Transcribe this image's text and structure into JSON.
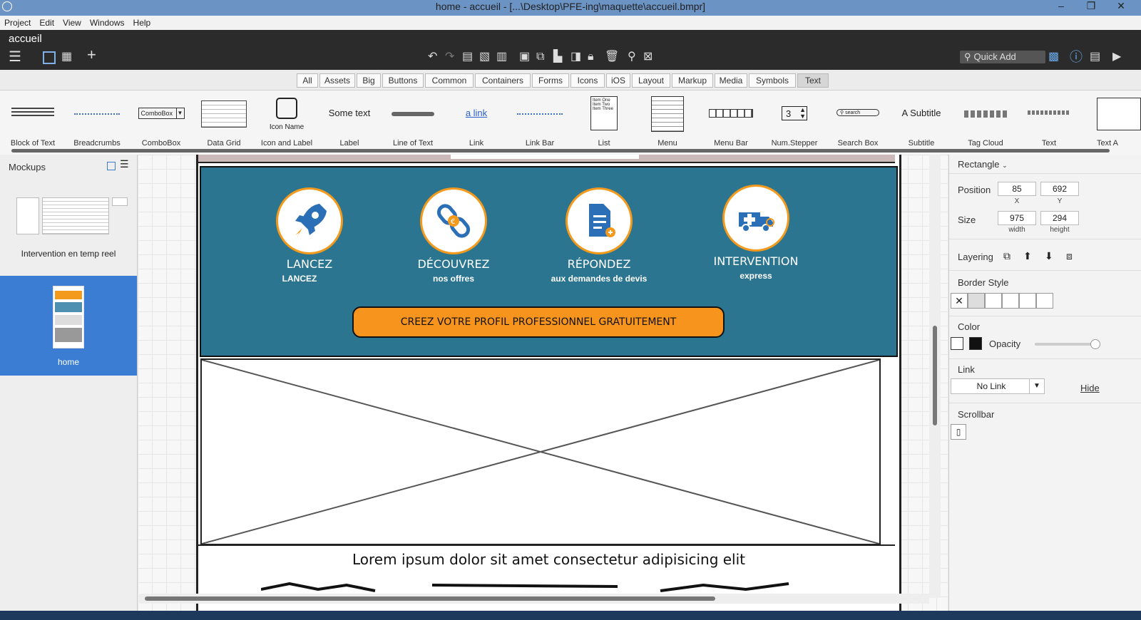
{
  "window": {
    "title": "home - accueil - [...\\Desktop\\PFE-ing\\maquette\\accueil.bmpr]",
    "minimize": "–",
    "maximize": "❐",
    "close": "✕"
  },
  "menubar": [
    "Project",
    "Edit",
    "View",
    "Windows",
    "Help"
  ],
  "document_title": "accueil",
  "quick_add": "Quick Add",
  "filters": [
    "All",
    "Assets",
    "Big",
    "Buttons",
    "Common",
    "Containers",
    "Forms",
    "Icons",
    "iOS",
    "Layout",
    "Markup",
    "Media",
    "Symbols",
    "Text"
  ],
  "active_filter": "Text",
  "library": {
    "items": [
      {
        "label": "Block of Text"
      },
      {
        "label": "Breadcrumbs"
      },
      {
        "label": "ComboBox",
        "preview": "ComboBox"
      },
      {
        "label": "Data Grid"
      },
      {
        "label": "Icon and Label",
        "preview": "Icon Name"
      },
      {
        "label": "Label",
        "preview": "Some text"
      },
      {
        "label": "Line of Text"
      },
      {
        "label": "Link",
        "preview": "a link"
      },
      {
        "label": "Link Bar"
      },
      {
        "label": "List",
        "preview_lines": [
          "Item One",
          "Item Two",
          "Item Three"
        ]
      },
      {
        "label": "Menu"
      },
      {
        "label": "Menu Bar"
      },
      {
        "label": "Num.Stepper",
        "preview": "3"
      },
      {
        "label": "Search Box",
        "preview": "search"
      },
      {
        "label": "Subtitle",
        "preview": "A Subtitle"
      },
      {
        "label": "Tag Cloud"
      },
      {
        "label": "Text"
      },
      {
        "label": "Text A"
      }
    ]
  },
  "mockups": {
    "title": "Mockups",
    "items": [
      {
        "label": "Intervention en temp reel",
        "selected": false
      },
      {
        "label": "home",
        "selected": true
      }
    ]
  },
  "canvas": {
    "features": [
      {
        "title": "LANCEZ",
        "subtitle": "LANCEZ",
        "icon": "rocket-icon"
      },
      {
        "title": "DÉCOUVREZ",
        "subtitle": "nos offres",
        "icon": "link-euro-icon"
      },
      {
        "title": "RÉPONDEZ",
        "subtitle": "aux demandes de devis",
        "icon": "document-plus-icon"
      },
      {
        "title": "INTERVENTION",
        "subtitle": "express",
        "icon": "ambulance-icon"
      }
    ],
    "cta": "CREEZ VOTRE PROFIL PROFESSIONNEL GRATUITEMENT",
    "lorem": "Lorem ipsum dolor sit amet consectetur adipisicing elit",
    "colors": {
      "panel": "#2c7591",
      "accent": "#f7941d"
    }
  },
  "properties": {
    "element_type": "Rectangle",
    "position_label": "Position",
    "x": "85",
    "y": "692",
    "x_label": "X",
    "y_label": "Y",
    "size_label": "Size",
    "width": "975",
    "height": "294",
    "width_label": "width",
    "height_label": "height",
    "layering_label": "Layering",
    "border_style_label": "Border Style",
    "color_label": "Color",
    "opacity_label": "Opacity",
    "link_label": "Link",
    "link_value": "No Link",
    "hide_label": "Hide",
    "scrollbar_label": "Scrollbar"
  }
}
